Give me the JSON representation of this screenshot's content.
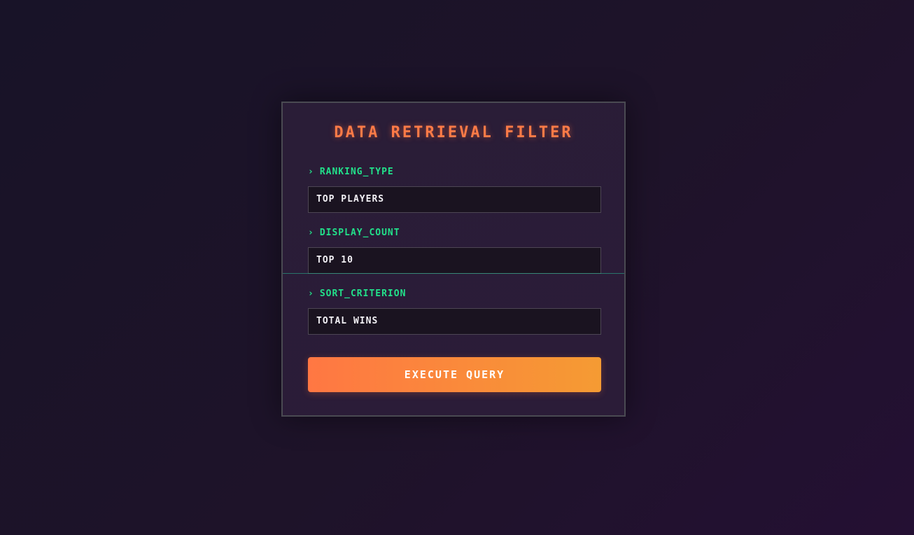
{
  "panel": {
    "title": "DATA RETRIEVAL FILTER",
    "fields": [
      {
        "label": "RANKING_TYPE",
        "value": "TOP PLAYERS"
      },
      {
        "label": "DISPLAY_COUNT",
        "value": "TOP 10"
      },
      {
        "label": "SORT_CRITERION",
        "value": "TOTAL WINS"
      }
    ],
    "chevron": "›",
    "button_label": "EXECUTE QUERY"
  },
  "colors": {
    "title": "#ff7b47",
    "label": "#22e08a",
    "button_start": "#ff7743",
    "button_end": "#f59b33"
  }
}
